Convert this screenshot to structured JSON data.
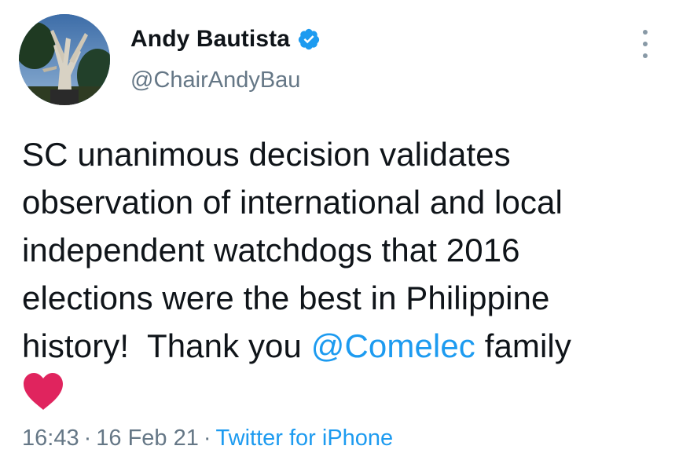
{
  "author": {
    "display_name": "Andy Bautista",
    "handle": "@ChairAndyBau",
    "verified": true,
    "avatar_icon": "profile-photo-tree"
  },
  "menu": {
    "icon": "more-vertical-icon"
  },
  "tweet": {
    "lines": [
      "SC unanimous decision validates",
      "observation of international and local",
      "independent watchdogs that 2016",
      "elections were the best in Philippine"
    ],
    "last_line_prefix": "history!  Thank you ",
    "mention": "@Comelec",
    "last_line_suffix": " family",
    "emoji": "red-heart-icon"
  },
  "meta": {
    "time": "16:43",
    "separator": "·",
    "date": "16 Feb 21",
    "source": "Twitter for iPhone"
  },
  "colors": {
    "link": "#1d9bf0",
    "muted": "#657786",
    "heart": "#e0245e",
    "verified": "#1d9bf0"
  }
}
